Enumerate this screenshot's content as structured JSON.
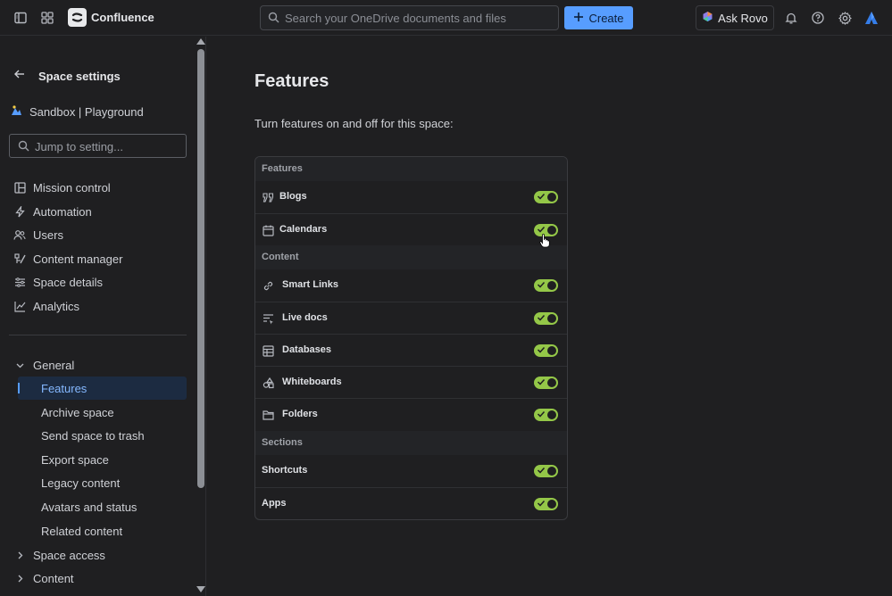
{
  "topbar": {
    "app_name": "Confluence",
    "search_placeholder": "Search your OneDrive documents and files",
    "create_label": "Create",
    "ask_rovo_label": "Ask Rovo",
    "icons": [
      "sidebar-toggle-icon",
      "app-switcher-icon",
      "confluence-logo-icon",
      "search-icon",
      "plus-icon",
      "rovo-icon",
      "bell-icon",
      "help-icon",
      "gear-icon",
      "atlassian-logo-icon"
    ]
  },
  "sidebar": {
    "back_label": "Space settings",
    "space_name": "Sandbox | Playground",
    "jump_placeholder": "Jump to setting...",
    "items": [
      {
        "label": "Mission control",
        "icon": "layout-icon"
      },
      {
        "label": "Automation",
        "icon": "lightning-icon"
      },
      {
        "label": "Users",
        "icon": "people-icon"
      },
      {
        "label": "Content manager",
        "icon": "content-manager-icon"
      },
      {
        "label": "Space details",
        "icon": "sliders-icon"
      },
      {
        "label": "Analytics",
        "icon": "chart-line-icon"
      }
    ],
    "general_label": "General",
    "general_items": [
      {
        "label": "Features",
        "active": true
      },
      {
        "label": "Archive space"
      },
      {
        "label": "Send space to trash"
      },
      {
        "label": "Export space"
      },
      {
        "label": "Legacy content"
      },
      {
        "label": "Avatars and status"
      },
      {
        "label": "Related content"
      }
    ],
    "collapsed_groups": [
      "Space access",
      "Content"
    ]
  },
  "main": {
    "title": "Features",
    "description": "Turn features on and off for this space:",
    "sections": [
      {
        "heading": "Features",
        "rows": [
          {
            "label": "Blogs",
            "icon": "quote-icon",
            "enabled": true
          },
          {
            "label": "Calendars",
            "icon": "calendar-icon",
            "enabled": true
          }
        ]
      },
      {
        "heading": "Content",
        "rows": [
          {
            "label": "Smart Links",
            "icon": "link-icon",
            "enabled": true
          },
          {
            "label": "Live docs",
            "icon": "live-doc-icon",
            "enabled": true
          },
          {
            "label": "Databases",
            "icon": "database-icon",
            "enabled": true
          },
          {
            "label": "Whiteboards",
            "icon": "whiteboard-icon",
            "enabled": true
          },
          {
            "label": "Folders",
            "icon": "folder-icon",
            "enabled": true
          }
        ]
      },
      {
        "heading": "Sections",
        "rows": [
          {
            "label": "Shortcuts",
            "icon": "",
            "enabled": true
          },
          {
            "label": "Apps",
            "icon": "",
            "enabled": true
          }
        ]
      }
    ]
  },
  "colors": {
    "toggle_on": "#94c748",
    "primary": "#579dff",
    "background": "#1f1f21"
  }
}
